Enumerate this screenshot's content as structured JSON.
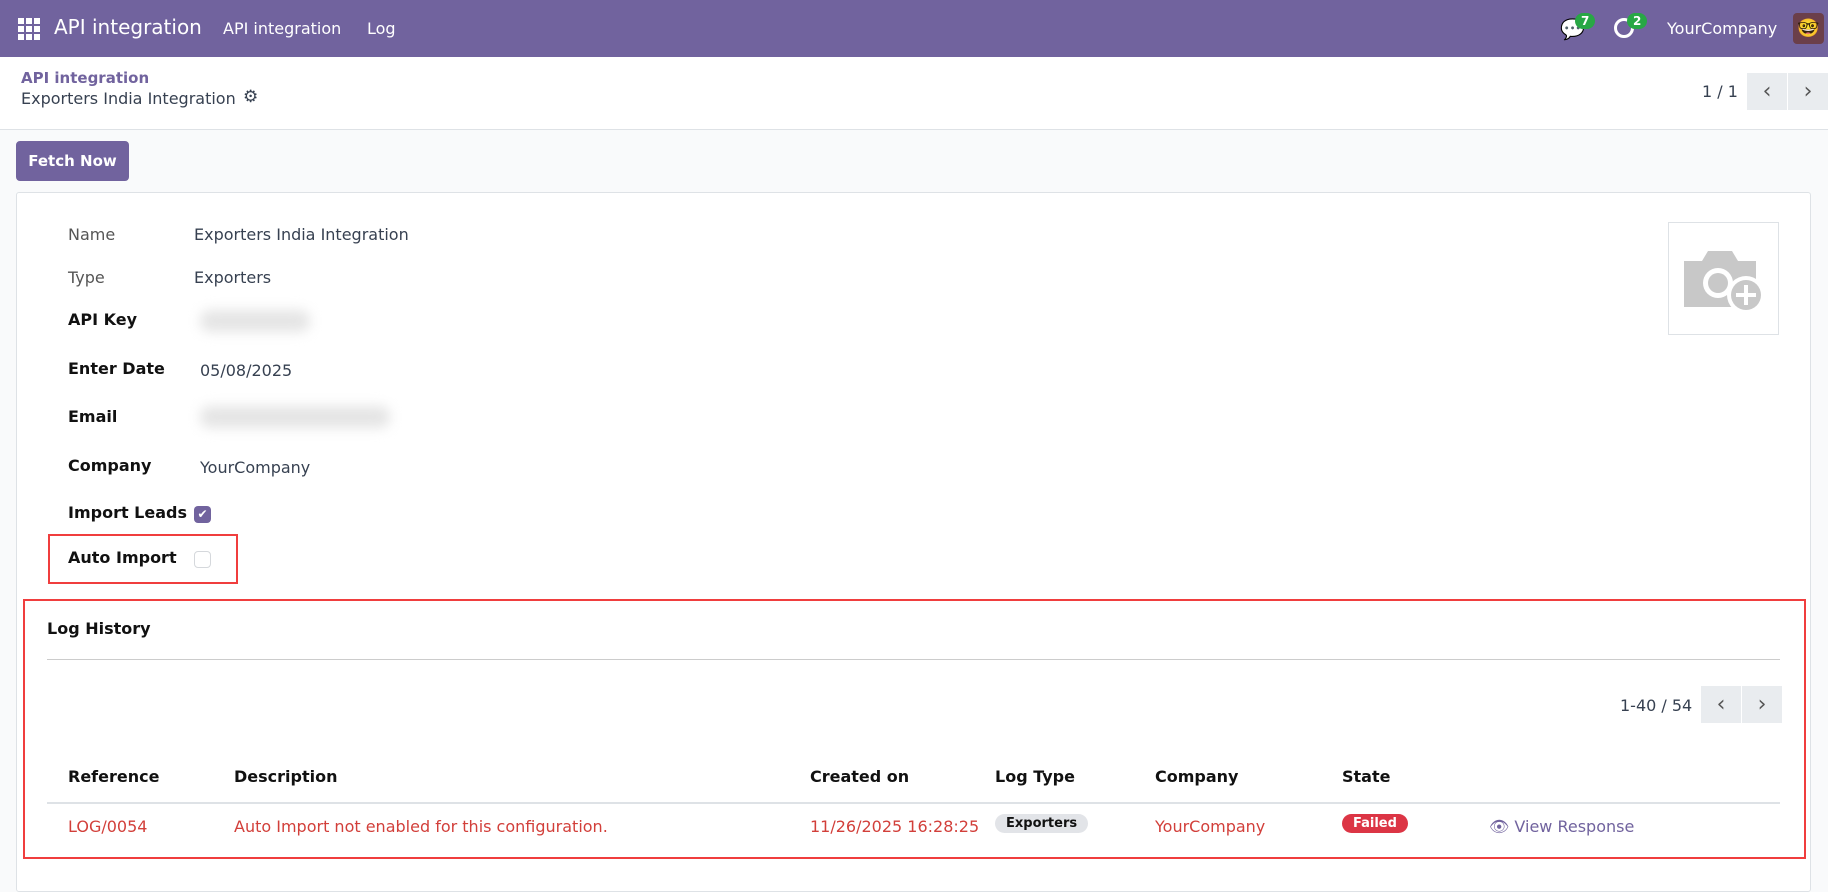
{
  "navbar": {
    "app_title": "API integration",
    "menu": [
      "API integration",
      "Log"
    ],
    "messages_count": "7",
    "activities_count": "2",
    "company": "YourCompany"
  },
  "header": {
    "breadcrumb_parent": "API integration",
    "record_title": "Exporters India Integration",
    "pager": "1 / 1"
  },
  "actions": {
    "fetch_now": "Fetch Now"
  },
  "form": {
    "name_label": "Name",
    "name_value": "Exporters India Integration",
    "type_label": "Type",
    "type_value": "Exporters",
    "api_key_label": "API Key",
    "enter_date_label": "Enter Date",
    "enter_date_value": "05/08/2025",
    "email_label": "Email",
    "company_label": "Company",
    "company_value": "YourCompany",
    "import_leads_label": "Import Leads",
    "import_leads_checked": true,
    "auto_import_label": "Auto Import",
    "auto_import_checked": false
  },
  "log_history": {
    "title": "Log History",
    "pager": "1-40 / 54",
    "columns": [
      "Reference",
      "Description",
      "Created on",
      "Log Type",
      "Company",
      "State"
    ],
    "rows": [
      {
        "reference": "LOG/0054",
        "description": "Auto Import not enabled for this configuration.",
        "created_on": "11/26/2025 16:28:25",
        "log_type": "Exporters",
        "company": "YourCompany",
        "state": "Failed",
        "action": "View Response"
      }
    ]
  },
  "colors": {
    "brand": "#71639e",
    "error_text": "#d23f3a",
    "failed_badge": "#dc3545",
    "highlight_box": "#f03e3e"
  }
}
